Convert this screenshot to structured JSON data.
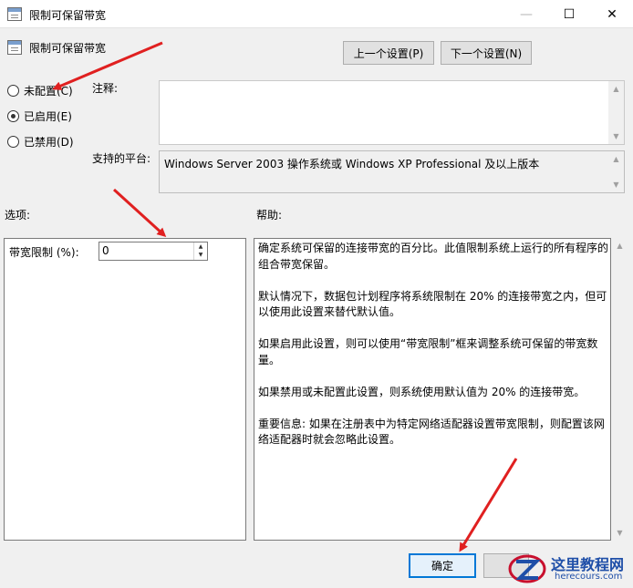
{
  "window": {
    "title": "限制可保留带宽",
    "controls": {
      "minimize": "—",
      "maximize": "☐",
      "close": "✕"
    }
  },
  "policy_name": "限制可保留带宽",
  "nav": {
    "prev": "上一个设置(P)",
    "next": "下一个设置(N)"
  },
  "radios": [
    {
      "label": "未配置(C)",
      "checked": false
    },
    {
      "label": "已启用(E)",
      "checked": true
    },
    {
      "label": "已禁用(D)",
      "checked": false
    }
  ],
  "comment": {
    "label": "注释:",
    "value": ""
  },
  "platform": {
    "label": "支持的平台:",
    "value": "Windows Server 2003 操作系统或 Windows XP Professional 及以上版本"
  },
  "options": {
    "label": "选项:",
    "bandwidth_label": "带宽限制 (%):",
    "bandwidth_value": "0"
  },
  "help": {
    "label": "帮助:",
    "paragraphs": [
      "确定系统可保留的连接带宽的百分比。此值限制系统上运行的所有程序的组合带宽保留。",
      "默认情况下，数据包计划程序将系统限制在 20% 的连接带宽之内，但可以使用此设置来替代默认值。",
      "如果启用此设置，则可以使用“带宽限制”框来调整系统可保留的带宽数量。",
      "如果禁用或未配置此设置，则系统使用默认值为 20% 的连接带宽。",
      "重要信息: 如果在注册表中为特定网络适配器设置带宽限制，则配置该网络适配器时就会忽略此设置。"
    ]
  },
  "footer": {
    "ok": "确定"
  },
  "watermark": {
    "brand": "这里教程网",
    "url": "herecours.com"
  },
  "colors": {
    "annotation_arrow": "#e02020",
    "focus_border": "#0078d7"
  }
}
